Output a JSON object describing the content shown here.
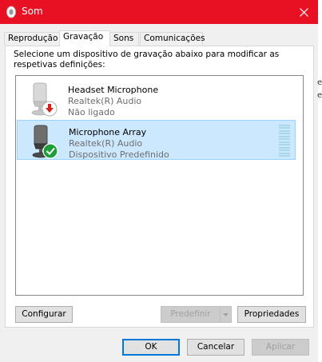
{
  "window": {
    "title": "Som",
    "close_label": "Fechar"
  },
  "tabs": [
    {
      "label": "Reprodução",
      "active": false
    },
    {
      "label": "Gravação",
      "active": true
    },
    {
      "label": "Sons",
      "active": false
    },
    {
      "label": "Comunicações",
      "active": false
    }
  ],
  "instructions": "Selecione um dispositivo de gravação abaixo para modificar as respetivas definições:",
  "devices": [
    {
      "name": "Headset Microphone",
      "driver": "Realtek(R) Audio",
      "status": "Não ligado",
      "badge": "red-down-arrow-icon",
      "selected": false
    },
    {
      "name": "Microphone Array",
      "driver": "Realtek(R) Audio",
      "status": "Dispositivo Predefinido",
      "badge": "green-check-icon",
      "selected": true,
      "level": 0
    }
  ],
  "buttons": {
    "configure": "Configurar",
    "set_default": "Predefinir",
    "properties": "Propriedades",
    "ok": "OK",
    "cancel": "Cancelar",
    "apply": "Aplicar"
  },
  "colors": {
    "titlebar": "#e81123",
    "selection": "#cce8ff",
    "primary_border": "#0078d7"
  },
  "background_fragments": [
    "e",
    "e"
  ]
}
